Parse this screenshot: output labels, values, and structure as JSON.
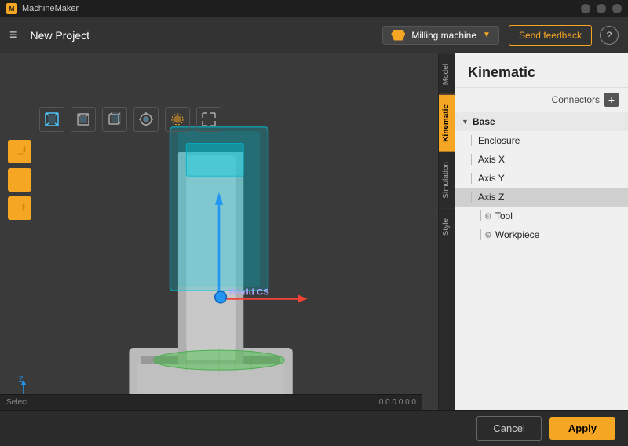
{
  "titlebar": {
    "app_name": "MachineMaker",
    "minimize_label": "−",
    "maximize_label": "□",
    "close_label": "×"
  },
  "toolbar": {
    "menu_icon": "≡",
    "project_title": "New Project",
    "machine_name": "Milling machine",
    "feedback_label": "Send feedback",
    "help_label": "?"
  },
  "view_tools": {
    "perspective_label": "Perspective view",
    "front_label": "Front view",
    "side_label": "Side view",
    "rotate_label": "Rotate",
    "light_label": "Light",
    "expand_label": "Expand"
  },
  "left_tools": {
    "cube1_label": "Solid cube",
    "cube2_label": "Wire cube",
    "cube3_label": "Shaded cube"
  },
  "world_cs": "World CS",
  "viewport": {
    "camera_label": "⊙"
  },
  "tabs": [
    {
      "id": "model",
      "label": "Model",
      "active": false
    },
    {
      "id": "kinematic",
      "label": "Kinematic",
      "active": true
    },
    {
      "id": "simulation",
      "label": "Simulation",
      "active": false
    },
    {
      "id": "style",
      "label": "Style",
      "active": false
    }
  ],
  "right_panel": {
    "title": "Kinematic",
    "connectors_label": "Connectors",
    "add_label": "+",
    "tree": {
      "base_label": "Base",
      "items": [
        {
          "id": "enclosure",
          "label": "Enclosure",
          "indent": 1,
          "has_connector": false
        },
        {
          "id": "axis_x",
          "label": "Axis X",
          "indent": 1,
          "has_connector": false
        },
        {
          "id": "axis_y",
          "label": "Axis Y",
          "indent": 1,
          "has_connector": false
        },
        {
          "id": "axis_z",
          "label": "Axis Z",
          "indent": 1,
          "has_connector": false,
          "selected": true
        },
        {
          "id": "tool",
          "label": "Tool",
          "indent": 2,
          "has_connector": true
        },
        {
          "id": "workpiece",
          "label": "Workpiece",
          "indent": 2,
          "has_connector": true
        }
      ]
    }
  },
  "actions": {
    "cancel_label": "Cancel",
    "apply_label": "Apply"
  },
  "statusbar": {
    "mode": "Select",
    "coords": "0.0 0.0 0.0"
  }
}
